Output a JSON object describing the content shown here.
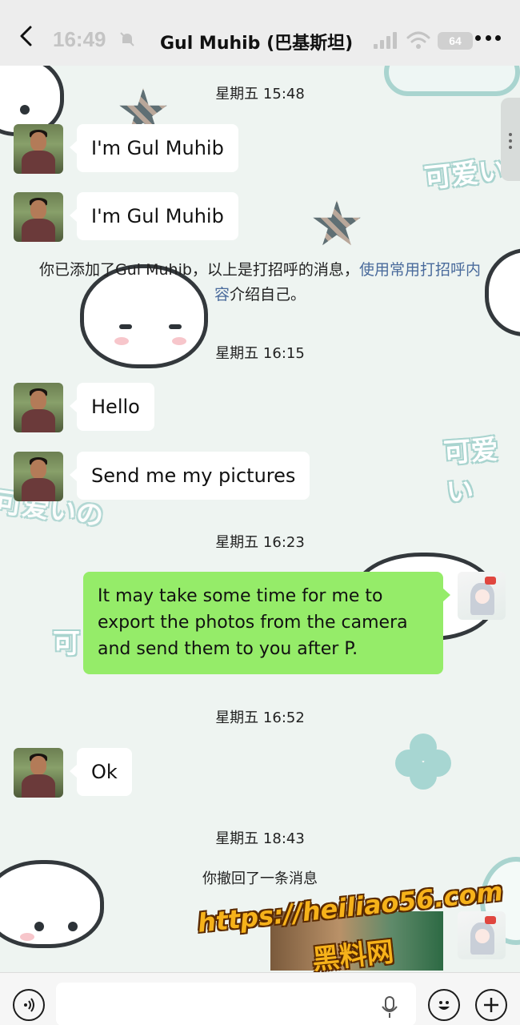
{
  "header": {
    "status_time": "16:49",
    "battery": "64",
    "title": "Gul Muhib (巴基斯坦)"
  },
  "wallpaper": {
    "doodle_1": "可爱い",
    "doodle_2": "可爱い",
    "doodle_3": "可爱いの",
    "doodle_4": "可"
  },
  "messages": {
    "ts1": "星期五 15:48",
    "msg1": "I'm Gul Muhib",
    "msg2": "I'm Gul Muhib",
    "system_note_prefix": "你已添加了Gul Muhib，以上是打招呼的消息，",
    "system_note_link": "使用常用打招呼内容",
    "system_note_suffix": "介绍自己。",
    "ts2": "星期五 16:15",
    "msg3": "Hello",
    "msg4": "Send me my pictures",
    "ts3": "星期五 16:23",
    "msg5": "It may take some time for me to export the photos from the camera and send them to you after P.",
    "ts4": "星期五 16:52",
    "msg6": "Ok",
    "ts5": "星期五 18:43",
    "recall_note": "你撤回了一条消息"
  },
  "watermark": {
    "url": "https://heiliao56.com",
    "name": "黑料网"
  },
  "input": {
    "placeholder": ""
  },
  "colors": {
    "my_bubble": "#95ec69",
    "their_bubble": "#ffffff",
    "link": "#4a6b9c",
    "watermark": "#f6b21a"
  },
  "icons": [
    "back-arrow-icon",
    "mute-bell-icon",
    "signal-icon",
    "wifi-icon",
    "more-icon",
    "voice-icon",
    "mic-icon",
    "emoji-icon",
    "plus-icon"
  ]
}
